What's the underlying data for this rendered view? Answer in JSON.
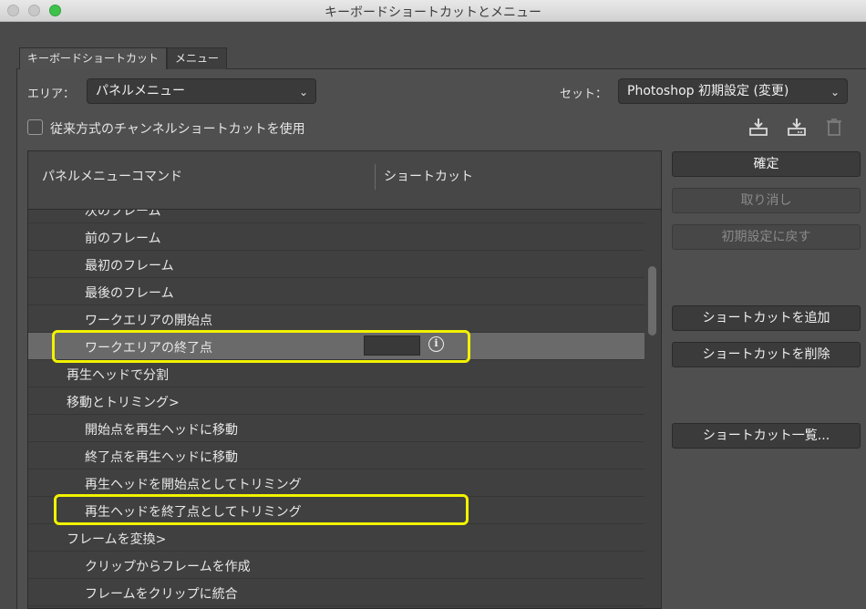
{
  "window": {
    "title": "キーボードショートカットとメニュー"
  },
  "tabs": [
    {
      "label": "キーボードショートカット",
      "active": true
    },
    {
      "label": "メニュー",
      "active": false
    }
  ],
  "area": {
    "label": "エリア：",
    "value": "パネルメニュー"
  },
  "set": {
    "label": "セット：",
    "value": "Photoshop 初期設定 (変更)"
  },
  "legacy_channel": {
    "label": "従来方式のチャンネルショートカットを使用",
    "checked": false
  },
  "toolbar_icons": [
    "save-set-icon",
    "save-set-as-icon",
    "trash-icon"
  ],
  "table": {
    "col_command": "パネルメニューコマンド",
    "col_shortcut": "ショートカット",
    "rows": [
      {
        "label": "次のフレーム",
        "indent": 2
      },
      {
        "label": "前のフレーム",
        "indent": 2
      },
      {
        "label": "最初のフレーム",
        "indent": 2
      },
      {
        "label": "最後のフレーム",
        "indent": 2
      },
      {
        "label": "ワークエリアの開始点",
        "indent": 2
      },
      {
        "label": "ワークエリアの終了点",
        "indent": 2,
        "selected": true
      },
      {
        "label": "再生ヘッドで分割",
        "indent": 1
      },
      {
        "label": "移動とトリミング>",
        "indent": 1
      },
      {
        "label": "開始点を再生ヘッドに移動",
        "indent": 2
      },
      {
        "label": "終了点を再生ヘッドに移動",
        "indent": 2
      },
      {
        "label": "再生ヘッドを開始点としてトリミング",
        "indent": 2
      },
      {
        "label": "再生ヘッドを終了点としてトリミング",
        "indent": 2
      },
      {
        "label": "フレームを変換>",
        "indent": 1
      },
      {
        "label": "クリップからフレームを作成",
        "indent": 2
      },
      {
        "label": "フレームをクリップに統合",
        "indent": 2
      }
    ],
    "selected_info_icon": "i"
  },
  "buttons": {
    "ok": "確定",
    "undo": "取り消し",
    "defaults": "初期設定に戻す",
    "add_shortcut": "ショートカットを追加",
    "delete_shortcut": "ショートカットを削除",
    "summarize": "ショートカット一覧..."
  },
  "colors": {
    "highlight": "#f2f200",
    "selected_row": "#6a6a6a"
  }
}
